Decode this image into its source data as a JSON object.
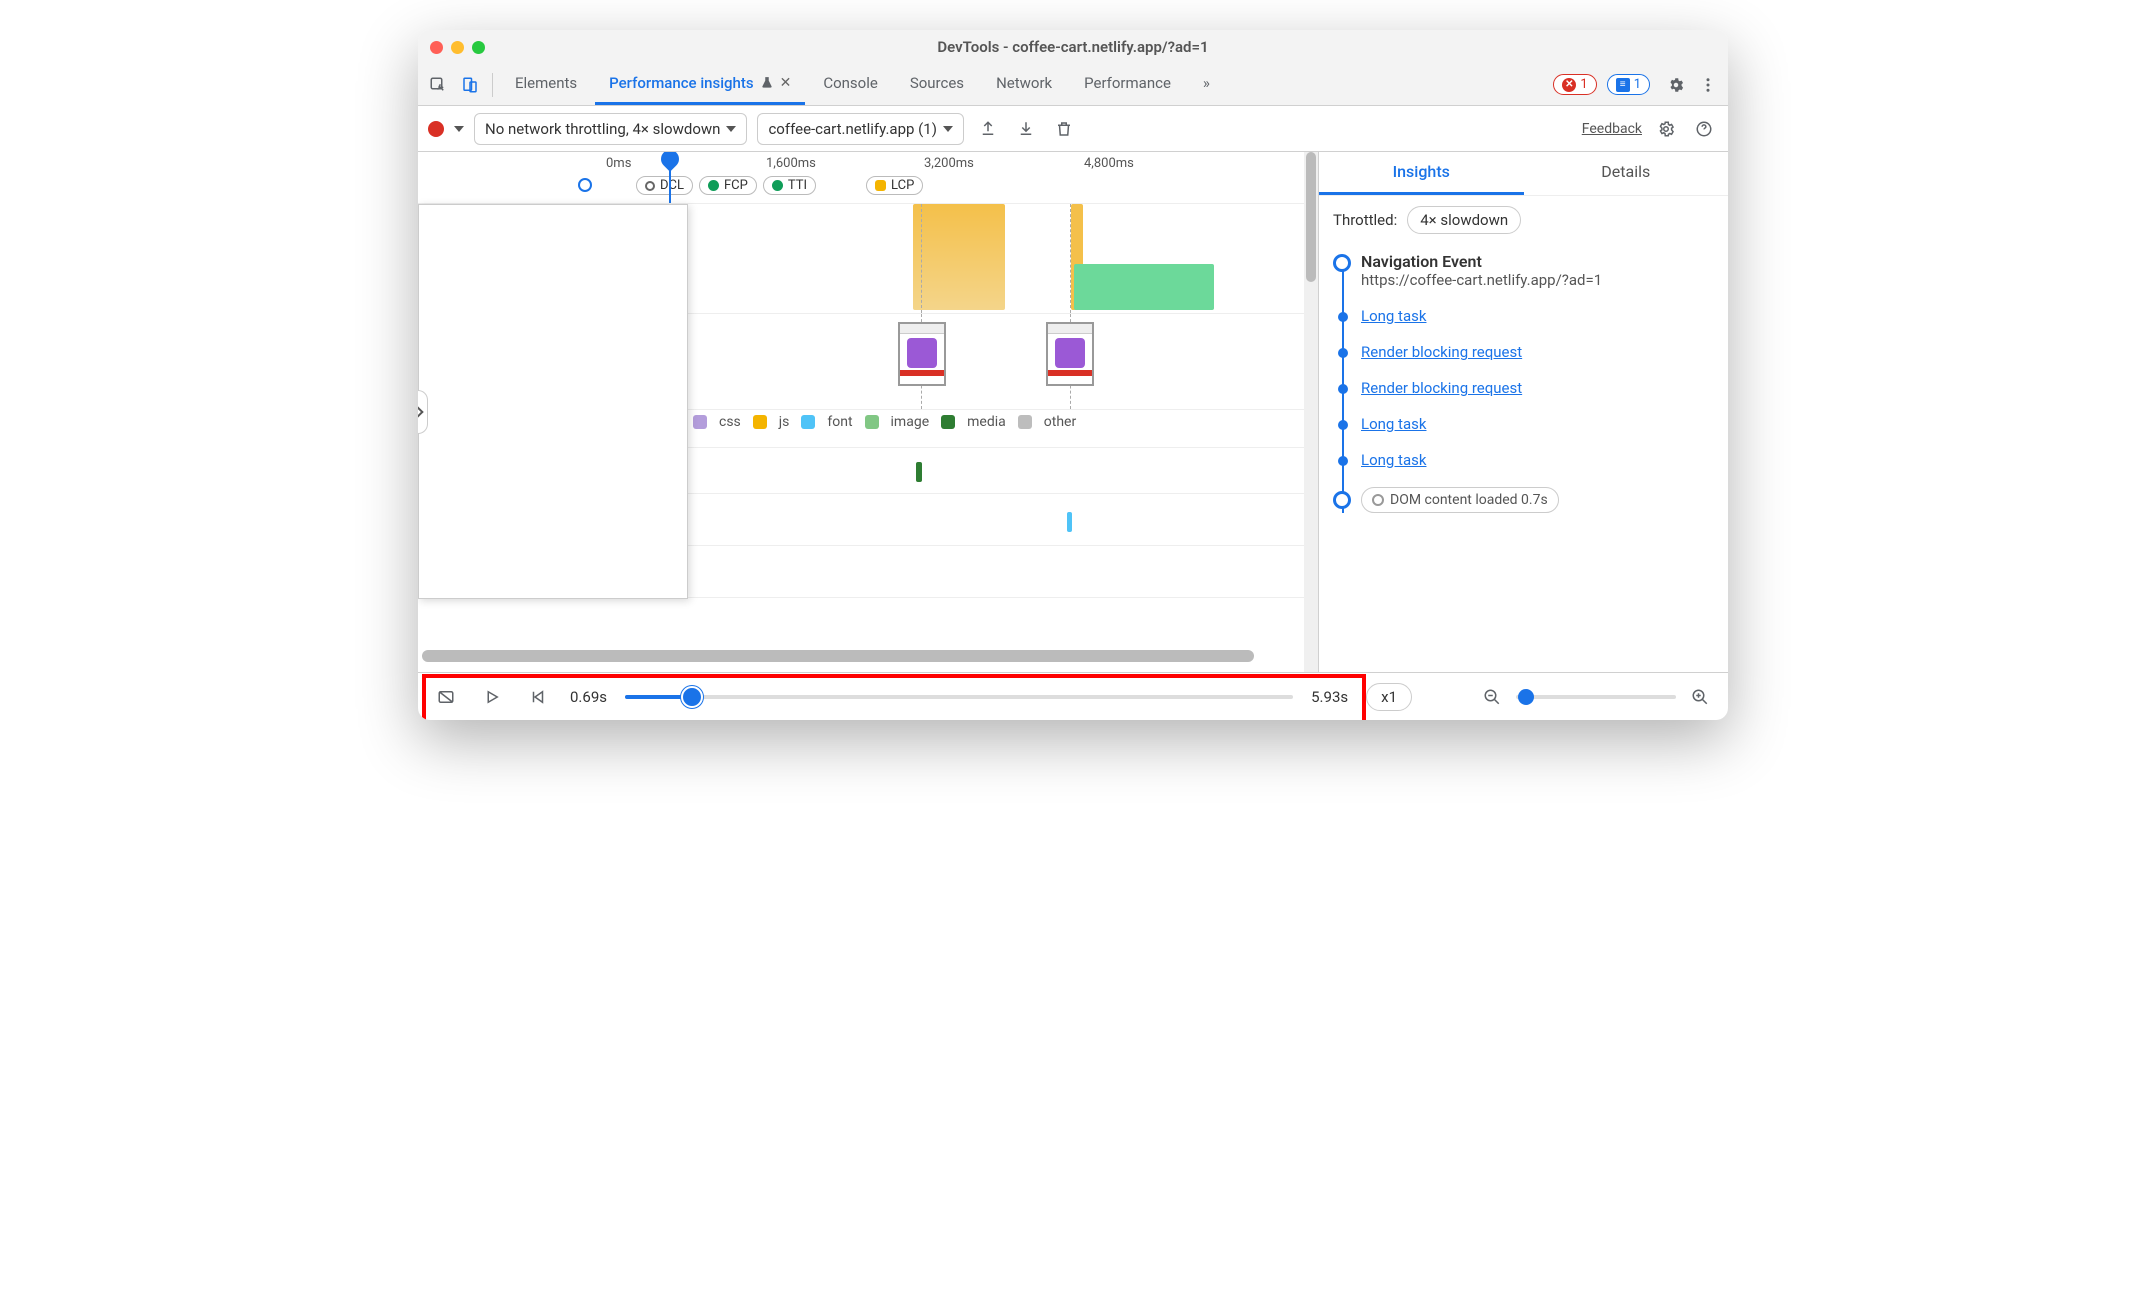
{
  "window": {
    "title": "DevTools - coffee-cart.netlify.app/?ad=1"
  },
  "tabs": {
    "elements": "Elements",
    "perf_insights": "Performance insights",
    "console": "Console",
    "sources": "Sources",
    "network": "Network",
    "performance": "Performance",
    "overflow": "»",
    "errors_count": "1",
    "messages_count": "1"
  },
  "toolbar": {
    "throttle_select": "No network throttling, 4× slowdown",
    "page_select": "coffee-cart.netlify.app (1)",
    "feedback": "Feedback"
  },
  "timeline": {
    "ticks": {
      "t0": "0ms",
      "t1": "1,600ms",
      "t2": "3,200ms",
      "t3": "4,800ms"
    },
    "markers": {
      "dcl": "DCL",
      "fcp": "FCP",
      "tti": "TTI",
      "lcp": "LCP"
    },
    "legend": {
      "css": "css",
      "js": "js",
      "font": "font",
      "image": "image",
      "media": "media",
      "other": "other"
    }
  },
  "sidepanel": {
    "tab_insights": "Insights",
    "tab_details": "Details",
    "throttled_label": "Throttled:",
    "throttled_value": "4× slowdown",
    "nav_event": "Navigation Event",
    "nav_url": "https://coffee-cart.netlify.app/?ad=1",
    "items": {
      "i0": "Long task",
      "i1": "Render blocking request",
      "i2": "Render blocking request",
      "i3": "Long task",
      "i4": "Long task"
    },
    "dom_loaded": "DOM content loaded 0.7s"
  },
  "footer": {
    "start_time": "0.69s",
    "end_time": "5.93s",
    "speed": "x1"
  }
}
